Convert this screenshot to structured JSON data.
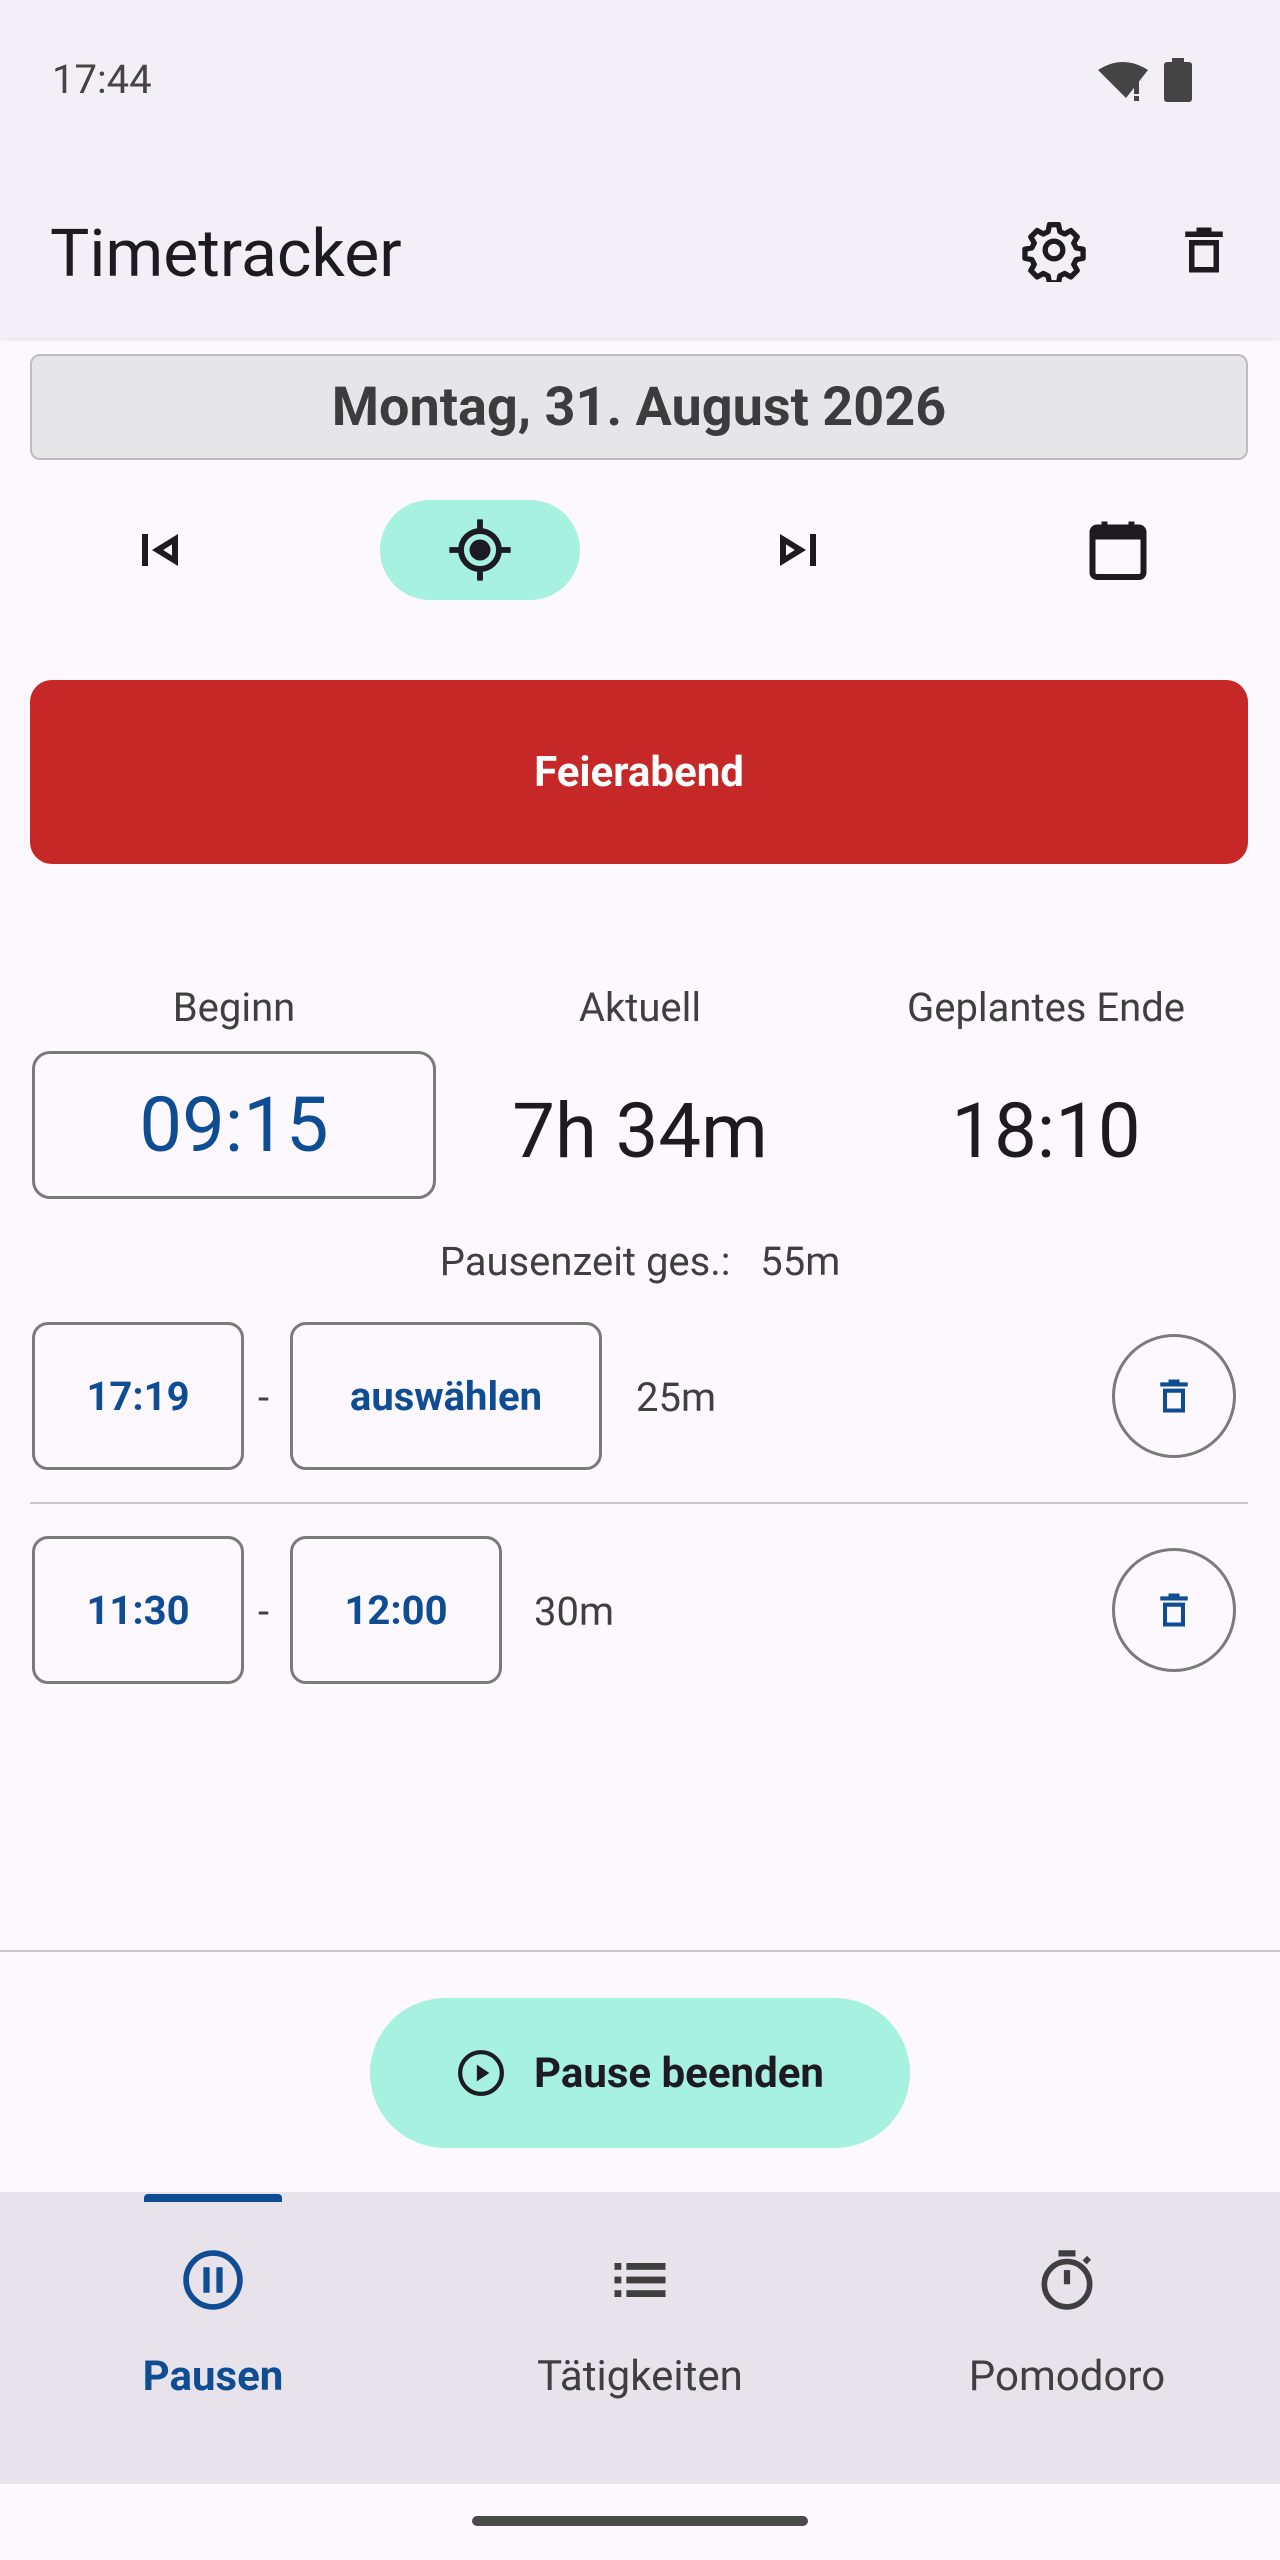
{
  "status_bar": {
    "time": "17:44"
  },
  "app_bar": {
    "title": "Timetracker",
    "icons": [
      "gear-icon",
      "trash-icon"
    ]
  },
  "date": {
    "label": "Montag, 31. August 2026"
  },
  "date_nav": {
    "icons": [
      "skip-previous-icon",
      "target-icon",
      "skip-next-icon",
      "calendar-icon"
    ],
    "active": "target-icon"
  },
  "main_action": {
    "label": "Feierabend",
    "color": "#c62828"
  },
  "summary": {
    "begin_label": "Beginn",
    "current_label": "Aktuell",
    "planned_end_label": "Geplantes Ende",
    "begin_value": "09:15",
    "current_value": "7h 34m",
    "planned_end_value": "18:10"
  },
  "pause_total": {
    "label": "Pausenzeit ges.:",
    "value": "55m"
  },
  "pauses": [
    {
      "start": "17:19",
      "separator": "-",
      "end": "auswählen",
      "duration": "25m"
    },
    {
      "start": "11:30",
      "separator": "-",
      "end": "12:00",
      "duration": "30m"
    }
  ],
  "fab": {
    "label": "Pause beenden",
    "icon": "play-circle-icon",
    "color": "#a7f1e0"
  },
  "bottom_nav": {
    "items": [
      {
        "label": "Pausen",
        "icon": "pause-circle-icon",
        "active": true
      },
      {
        "label": "Tätigkeiten",
        "icon": "list-icon",
        "active": false
      },
      {
        "label": "Pomodoro",
        "icon": "stopwatch-icon",
        "active": false
      }
    ]
  },
  "colors": {
    "accent": "#0e4d94",
    "background": "#fdf8fd",
    "teal": "#a7f1e0",
    "red": "#c62828"
  }
}
